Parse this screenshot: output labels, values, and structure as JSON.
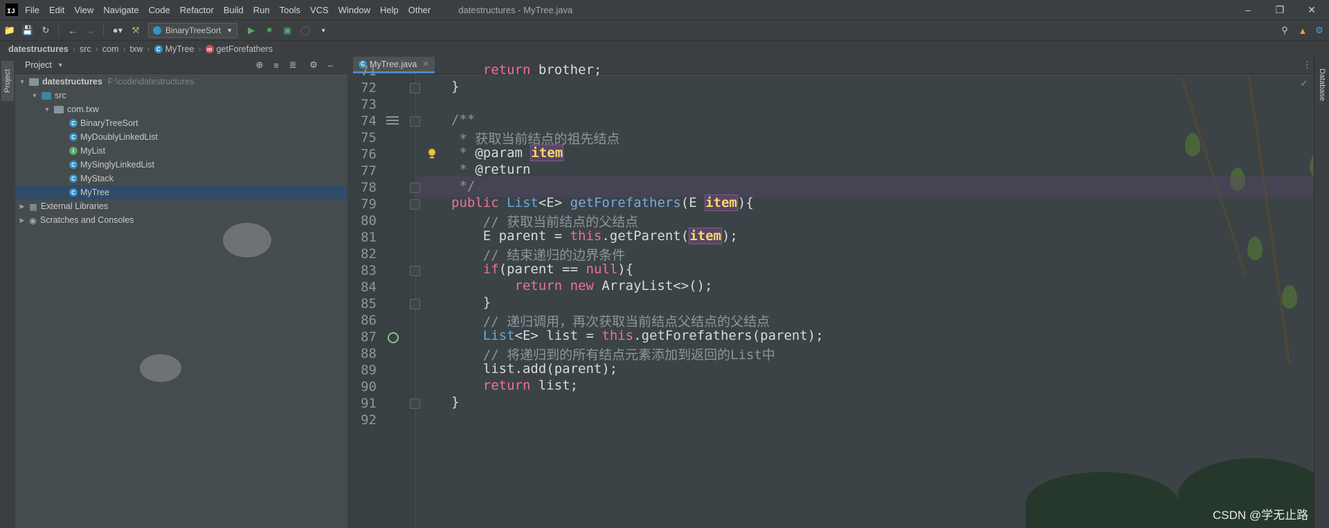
{
  "window": {
    "title": "datestructures - MyTree.java",
    "logo": "IJ",
    "controls": [
      "minimize-icon",
      "restore-icon",
      "close-icon"
    ]
  },
  "menu": [
    "File",
    "Edit",
    "View",
    "Navigate",
    "Code",
    "Refactor",
    "Build",
    "Run",
    "Tools",
    "VCS",
    "Window",
    "Help",
    "Other"
  ],
  "toolbar": {
    "run_config": "BinaryTreeSort",
    "icons": [
      "open-icon",
      "save-icon",
      "sync-icon",
      "back-icon",
      "forward-icon",
      "user-icon",
      "build-icon",
      "run-icon",
      "debug-icon",
      "coverage-icon",
      "stop-icon",
      "more-icon",
      "search-icon",
      "update-icon",
      "settings-icon"
    ]
  },
  "breadcrumb": [
    "datestructures",
    "src",
    "com",
    "txw",
    "MyTree",
    "getForefathers"
  ],
  "project_panel": {
    "title": "Project",
    "side_tab": "Project",
    "tree": [
      {
        "label": "datestructures",
        "path": "F:\\code\\datestructures",
        "level": 0,
        "type": "module"
      },
      {
        "label": "src",
        "level": 1,
        "type": "src"
      },
      {
        "label": "com.txw",
        "level": 2,
        "type": "package"
      },
      {
        "label": "BinaryTreeSort",
        "level": 3,
        "type": "class"
      },
      {
        "label": "MyDoublyLinkedList",
        "level": 3,
        "type": "class"
      },
      {
        "label": "MyList",
        "level": 3,
        "type": "interface"
      },
      {
        "label": "MySinglyLinkedList",
        "level": 3,
        "type": "class"
      },
      {
        "label": "MyStack",
        "level": 3,
        "type": "class"
      },
      {
        "label": "MyTree",
        "level": 3,
        "type": "class",
        "selected": true
      },
      {
        "label": "External Libraries",
        "level": 0,
        "type": "library"
      },
      {
        "label": "Scratches and Consoles",
        "level": 0,
        "type": "scratch"
      }
    ]
  },
  "editor": {
    "tab": "MyTree.java",
    "lines": [
      {
        "n": "71",
        "text": "    return brother;"
      },
      {
        "n": "72",
        "text": "}"
      },
      {
        "n": "73",
        "text": ""
      },
      {
        "n": "74",
        "text": "/**"
      },
      {
        "n": "75",
        "text": " * 获取当前结点的祖先结点"
      },
      {
        "n": "76",
        "text": " * @param item"
      },
      {
        "n": "77",
        "text": " * @return"
      },
      {
        "n": "78",
        "text": " */"
      },
      {
        "n": "79",
        "text": "public List<E> getForefathers(E item){"
      },
      {
        "n": "80",
        "text": "    // 获取当前结点的父结点"
      },
      {
        "n": "81",
        "text": "    E parent = this.getParent(item);"
      },
      {
        "n": "82",
        "text": "    // 结束递归的边界条件"
      },
      {
        "n": "83",
        "text": "    if(parent == null){"
      },
      {
        "n": "84",
        "text": "        return new ArrayList<>();"
      },
      {
        "n": "85",
        "text": "    }"
      },
      {
        "n": "86",
        "text": "    // 递归调用，再次获取当前结点父结点的父结点"
      },
      {
        "n": "87",
        "text": "    List<E> list = this.getForefathers(parent);"
      },
      {
        "n": "88",
        "text": "    // 将递归到的所有结点元素添加到返回的List中"
      },
      {
        "n": "89",
        "text": "    list.add(parent);"
      },
      {
        "n": "90",
        "text": "    return list;"
      },
      {
        "n": "91",
        "text": "}"
      },
      {
        "n": "92",
        "text": ""
      }
    ]
  },
  "right_panel": {
    "side_tab": "Database"
  },
  "watermark": "CSDN @学无止路"
}
